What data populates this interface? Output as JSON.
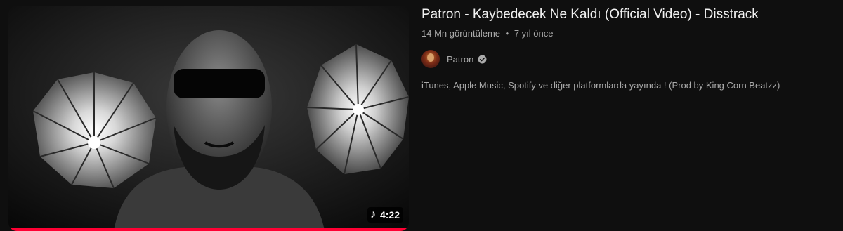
{
  "video": {
    "title": "Patron - Kaybedecek Ne Kaldı (Official Video) - Disstrack",
    "views": "14 Mn görüntüleme",
    "separator": "•",
    "age": "7 yıl önce",
    "channel_name": "Patron",
    "description": "iTunes, Apple Music, Spotify ve diğer platformlarda yayında ! (Prod by King Corn Beatzz)",
    "duration": "4:22",
    "watch_progress": 1.0,
    "icons": {
      "duration": "music-note-icon",
      "verified": "verified-badge-icon"
    },
    "colors": {
      "progress": "#ff0033",
      "background": "#0f0f0f",
      "title": "#f1f1f1",
      "secondary": "#aaaaaa"
    }
  }
}
